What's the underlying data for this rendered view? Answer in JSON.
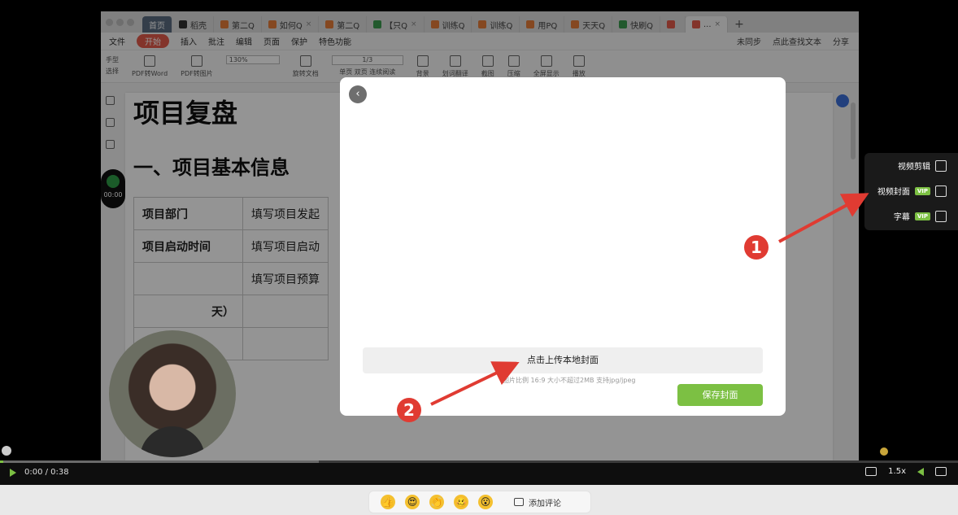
{
  "app": {
    "tabs": [
      {
        "label": "首页",
        "kind": "home"
      },
      {
        "label": "稻壳",
        "kind": "plain"
      },
      {
        "label": "第二Q",
        "kind": "doc"
      },
      {
        "label": "如何Q",
        "kind": "doc"
      },
      {
        "label": "第二Q",
        "kind": "doc"
      },
      {
        "label": "【只Q",
        "kind": "sheet"
      },
      {
        "label": "训练Q",
        "kind": "doc"
      },
      {
        "label": "训练Q",
        "kind": "doc"
      },
      {
        "label": "用PQ",
        "kind": "doc"
      },
      {
        "label": "天天Q",
        "kind": "doc"
      },
      {
        "label": "快刷Q",
        "kind": "sheet"
      },
      {
        "label": "",
        "kind": "doc"
      },
      {
        "label": "...",
        "kind": "active"
      }
    ],
    "menu": {
      "file": "文件",
      "start": "开始",
      "items": [
        "插入",
        "批注",
        "编辑",
        "页面",
        "保护",
        "特色功能"
      ],
      "sync": "未同步",
      "search": "点此查找文本",
      "share": "分享"
    },
    "ribbon": {
      "hand": "手型",
      "select": "选择",
      "pdf_to_word": "PDF转Word",
      "pdf_to_image": "PDF转图片",
      "zoom": "130%",
      "rotate": "旋转文档",
      "page": "1/3",
      "single": "单页",
      "double": "双页",
      "continuous": "连续阅读",
      "background": "背景",
      "translate": "划词翻译",
      "screenshot": "截图",
      "compress": "压缩",
      "fullscreen": "全屏显示",
      "play": "播放"
    },
    "recorder_time": "00:00"
  },
  "document": {
    "title": "项目复盘",
    "heading": "一、项目基本信息",
    "rows": [
      {
        "key": "项目部门",
        "value": "填写项目发起"
      },
      {
        "key": "项目启动时间",
        "value": "填写项目启动"
      },
      {
        "key": "",
        "value": "填写项目预算"
      },
      {
        "key": "天）",
        "value": ""
      },
      {
        "key": "",
        "value": ""
      }
    ]
  },
  "modal": {
    "upload_label": "点击上传本地封面",
    "upload_hint": "图片比例 16:9 大小不超过2MB 支持jpg/jpeg",
    "save_label": "保存封面"
  },
  "right_panel": {
    "items": [
      {
        "label": "视频剪辑",
        "vip": false,
        "icon": "video-edit-icon"
      },
      {
        "label": "视频封面",
        "vip": true,
        "icon": "image-icon"
      },
      {
        "label": "字幕",
        "vip": true,
        "icon": "text-icon"
      }
    ],
    "vip_label": "VIP"
  },
  "annotations": {
    "step1": "1",
    "step2": "2"
  },
  "player": {
    "time": "0:00 / 0:38",
    "played_fraction": 0.003,
    "speed": "1.5x"
  },
  "reactions": {
    "emojis": [
      "👍",
      "😍",
      "👏",
      "🥴",
      "😮"
    ],
    "comment_label": "添加评论"
  },
  "colors": {
    "accent_green": "#7cc043",
    "annotation_red": "#e03b32",
    "wps_red": "#e25b4a"
  }
}
